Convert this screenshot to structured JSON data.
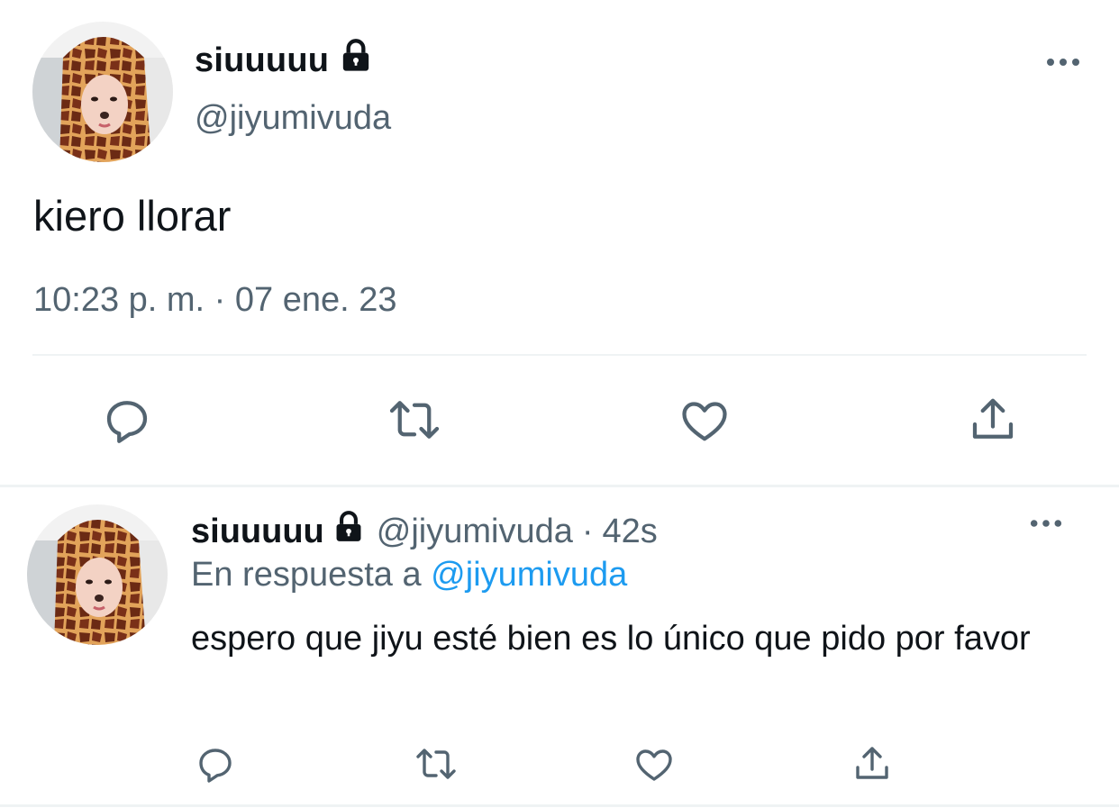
{
  "main_tweet": {
    "display_name": "siuuuuu",
    "handle": "@jiyumivuda",
    "text": "kiero llorar",
    "timestamp": "10:23 p. m. · 07 ene. 23",
    "locked_icon": "lock-icon",
    "more_icon": "more-horizontal-icon"
  },
  "reply_tweet": {
    "display_name": "siuuuuu",
    "handle": "@jiyumivuda",
    "separator": "·",
    "time_ago": "42s",
    "reply_context_prefix": "En respuesta a",
    "reply_context_handle": "@jiyumivuda",
    "text": "espero que jiyu esté bien es lo único que pido por favor",
    "locked_icon": "lock-icon",
    "more_icon": "more-horizontal-icon"
  },
  "actions": [
    "reply-icon",
    "retweet-icon",
    "like-icon",
    "share-icon"
  ],
  "colors": {
    "text": "#0f1419",
    "secondary": "#536471",
    "link": "#1d9bf0",
    "divider": "#eff3f4"
  }
}
